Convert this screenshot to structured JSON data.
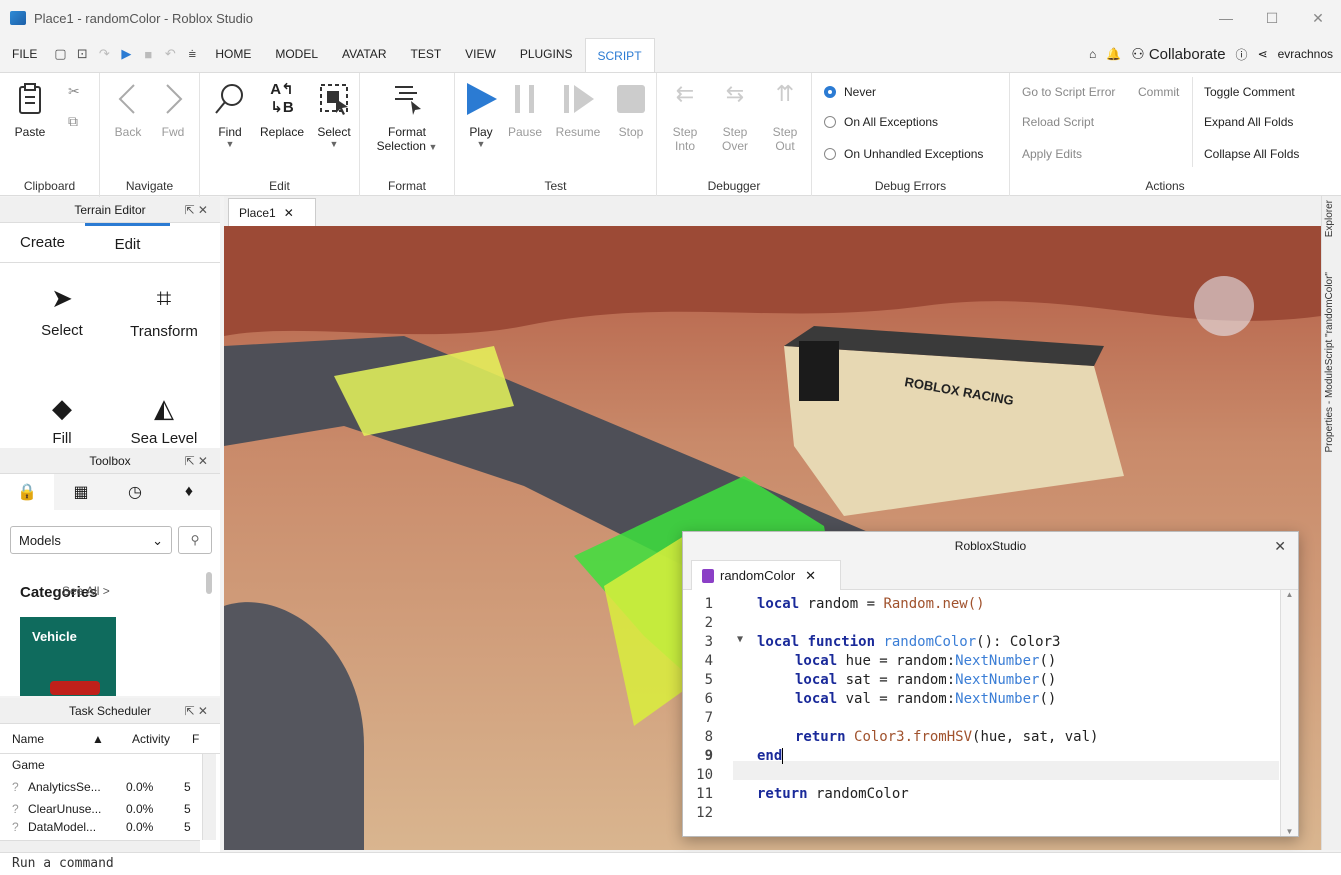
{
  "window": {
    "title": "Place1 - randomColor - Roblox Studio",
    "minimize": "—",
    "maximize": "☐",
    "close": "✕"
  },
  "menu": {
    "file": "FILE",
    "tabs": [
      "HOME",
      "MODEL",
      "AVATAR",
      "TEST",
      "VIEW",
      "PLUGINS",
      "SCRIPT"
    ],
    "active_tab": "SCRIPT",
    "collaborate": "Collaborate",
    "username": "evrachnos"
  },
  "ribbon": {
    "clipboard": {
      "paste": "Paste",
      "label": "Clipboard"
    },
    "navigate": {
      "back": "Back",
      "fwd": "Fwd",
      "label": "Navigate"
    },
    "edit": {
      "find": "Find",
      "replace": "Replace",
      "select": "Select",
      "label": "Edit"
    },
    "format": {
      "line1": "Format",
      "line2": "Selection",
      "label": "Format"
    },
    "test": {
      "play": "Play",
      "pause": "Pause",
      "resume": "Resume",
      "stop": "Stop",
      "label": "Test"
    },
    "debugger": {
      "step_into_1": "Step",
      "step_into_2": "Into",
      "step_over_1": "Step",
      "step_over_2": "Over",
      "step_out_1": "Step",
      "step_out_2": "Out",
      "label": "Debugger"
    },
    "debug_errors": {
      "never": "Never",
      "all": "On All Exceptions",
      "unhandled": "On Unhandled Exceptions",
      "label": "Debug Errors"
    },
    "actions": {
      "goto_error": "Go to Script Error",
      "commit": "Commit",
      "reload": "Reload Script",
      "apply": "Apply Edits",
      "toggle_comment": "Toggle Comment",
      "expand": "Expand All Folds",
      "collapse": "Collapse All Folds",
      "label": "Actions"
    }
  },
  "terrain_editor": {
    "title": "Terrain Editor",
    "tabs": [
      "Create",
      "Edit"
    ],
    "tools": [
      "Select",
      "Transform",
      "Fill",
      "Sea Level"
    ]
  },
  "toolbox": {
    "title": "Toolbox",
    "dropdown": "Models",
    "categories": "Categories",
    "see_all": "See All >",
    "vehicle": "Vehicle"
  },
  "task_scheduler": {
    "title": "Task Scheduler",
    "col_name": "Name",
    "col_activity": "Activity",
    "col_f": "F",
    "group": "Game",
    "rows": [
      {
        "name": "AnalyticsSe...",
        "activity": "0.0%",
        "f": "5"
      },
      {
        "name": "ClearUnuse...",
        "activity": "0.0%",
        "f": "5"
      },
      {
        "name": "DataModel...",
        "activity": "0.0%",
        "f": "5"
      }
    ]
  },
  "viewport": {
    "tab": "Place1",
    "building_sign": "ROBLOX  RACING"
  },
  "right_dock": {
    "explorer": "Explorer",
    "properties": "Properties - ModuleScript \"randomColor\""
  },
  "script_window": {
    "title": "RobloxStudio",
    "tab": "randomColor",
    "line_numbers": [
      "1",
      "2",
      "3",
      "4",
      "5",
      "6",
      "7",
      "8",
      "9",
      "10",
      "11",
      "12"
    ],
    "code": {
      "l1_kw": "local",
      "l1_rest": " random = ",
      "l1_cls": "Random.new()",
      "l3_kw": "local function",
      "l3_fn": "randomColor",
      "l3_rest": "(): Color3",
      "l4_kw": "local",
      "l4_rest": " hue = random:",
      "l4_fn": "NextNumber",
      "l4_end": "()",
      "l5_kw": "local",
      "l5_rest": " sat = random:",
      "l5_fn": "NextNumber",
      "l5_end": "()",
      "l6_kw": "local",
      "l6_rest": " val = random:",
      "l6_fn": "NextNumber",
      "l6_end": "()",
      "l8_kw": "return",
      "l8_cls": "Color3.fromHSV",
      "l8_rest": "(hue, sat, val)",
      "l9_kw": "end",
      "l11_kw": "return",
      "l11_rest": " randomColor"
    }
  },
  "command_bar": {
    "placeholder": "Run a command"
  },
  "colors": {
    "accent": "#2b7bd3",
    "keyword": "#1a2a9a",
    "method": "#3b7ed6",
    "class": "#a0522d"
  }
}
